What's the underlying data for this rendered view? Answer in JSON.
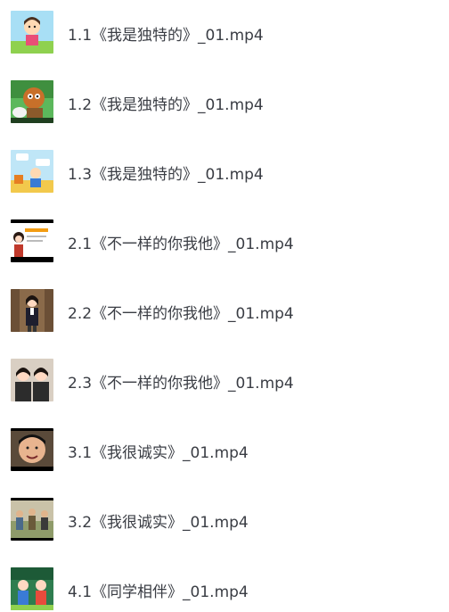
{
  "files": [
    {
      "name": "1.1《我是独特的》_01.mp4",
      "thumbnail": "cartoon-girl-thumbnail"
    },
    {
      "name": "1.2《我是独特的》_01.mp4",
      "thumbnail": "cartoon-animal-thumbnail"
    },
    {
      "name": "1.3《我是独特的》_01.mp4",
      "thumbnail": "cartoon-classroom-thumbnail"
    },
    {
      "name": "2.1《不一样的你我他》_01.mp4",
      "thumbnail": "girl-slide-thumbnail"
    },
    {
      "name": "2.2《不一样的你我他》_01.mp4",
      "thumbnail": "girl-standing-thumbnail"
    },
    {
      "name": "2.3《不一样的你我他》_01.mp4",
      "thumbnail": "two-students-thumbnail"
    },
    {
      "name": "3.1《我很诚实》_01.mp4",
      "thumbnail": "boy-closeup-thumbnail"
    },
    {
      "name": "3.2《我很诚实》_01.mp4",
      "thumbnail": "outdoor-scene-thumbnail"
    },
    {
      "name": "4.1《同学相伴》_01.mp4",
      "thumbnail": "classmates-thumbnail"
    }
  ]
}
